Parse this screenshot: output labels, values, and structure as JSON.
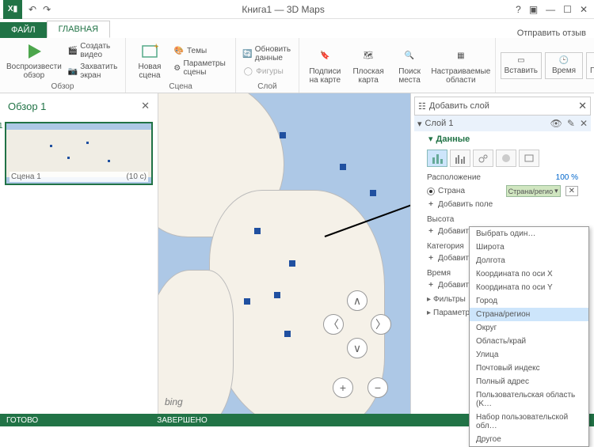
{
  "titlebar": {
    "app_glyph": "X▮",
    "title": "Книга1 — 3D Maps"
  },
  "tabs": {
    "file": "ФАЙЛ",
    "home": "ГЛАВНАЯ",
    "feedback": "Отправить отзыв"
  },
  "ribbon": {
    "g1": {
      "label": "Обзор",
      "play": "Воспроизвести обзор",
      "video": "Создать видео",
      "capture": "Захватить экран"
    },
    "g2": {
      "label": "Сцена",
      "scene": "Новая сцена",
      "themes": "Темы",
      "params": "Параметры сцены"
    },
    "g3": {
      "label": "Слой",
      "refresh": "Обновить данные",
      "shapes": "Фигуры"
    },
    "g4": {
      "labels": "Подписи на карте",
      "flat": "Плоская карта",
      "find": "Поиск места",
      "custom": "Настраиваемые области"
    },
    "g5": {
      "insert": "Вставить",
      "time": "Время",
      "view": "Просмотр"
    }
  },
  "tours": {
    "title": "Обзор 1",
    "scene_num": "1",
    "scene_name": "Сцена 1",
    "duration": "(10 с)"
  },
  "map": {
    "bing": "bing"
  },
  "layer": {
    "add": "Добавить слой",
    "layer1": "Слой 1",
    "data": "Данные",
    "location": "Расположение",
    "pct": "100 %",
    "country": "Страна",
    "country_type": "Страна/регио",
    "add_field": "Добавить поле",
    "height": "Высота",
    "category": "Категория",
    "time": "Время",
    "filters": "Фильтры",
    "options": "Параметры слоя"
  },
  "dropdown": {
    "items": [
      "Выбрать один…",
      "Широта",
      "Долгота",
      "Координата по оси X",
      "Координата по оси Y",
      "Город",
      "Страна/регион",
      "Округ",
      "Область/край",
      "Улица",
      "Почтовый индекс",
      "Полный адрес",
      "Пользовательская область (K…",
      "Набор пользовательской обл…",
      "Другое"
    ],
    "highlight_index": 6
  },
  "status": {
    "ready": "ГОТОВО",
    "done": "ЗАВЕРШЕНО"
  }
}
